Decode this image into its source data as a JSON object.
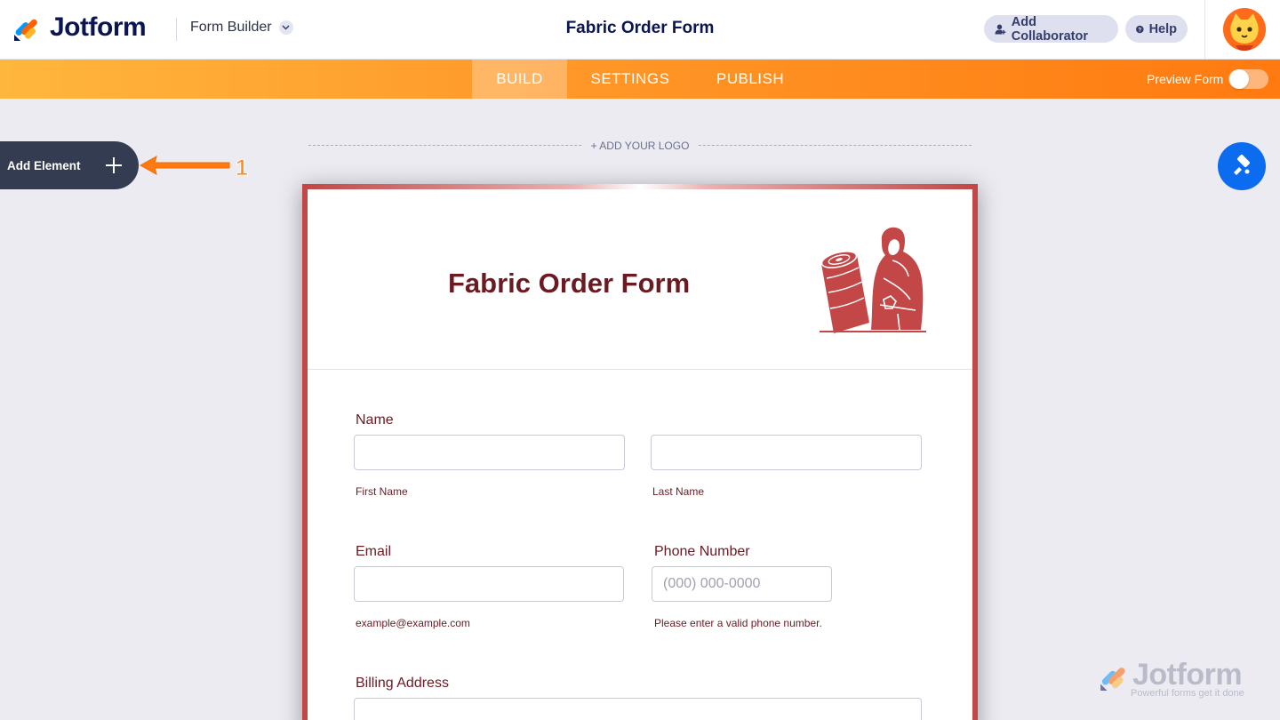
{
  "header": {
    "brand": "Jotform",
    "builder_label": "Form Builder",
    "form_title": "Fabric Order Form",
    "collaborator_label": "Add Collaborator",
    "help_label": "Help"
  },
  "nav": {
    "tabs": [
      {
        "label": "BUILD",
        "active": true
      },
      {
        "label": "SETTINGS",
        "active": false
      },
      {
        "label": "PUBLISH",
        "active": false
      }
    ],
    "preview_label": "Preview Form",
    "preview_on": false
  },
  "sidebar": {
    "add_element_label": "Add Element",
    "annotation_number": "1"
  },
  "canvas": {
    "add_logo_label": "+ ADD YOUR LOGO"
  },
  "form": {
    "heading": "Fabric Order Form",
    "name": {
      "label": "Name",
      "first_sublabel": "First Name",
      "last_sublabel": "Last Name",
      "first_value": "",
      "last_value": ""
    },
    "email": {
      "label": "Email",
      "value": "",
      "sublabel": "example@example.com"
    },
    "phone": {
      "label": "Phone Number",
      "placeholder": "(000) 000-0000",
      "sublabel": "Please enter a valid phone number."
    },
    "billing": {
      "label": "Billing Address"
    }
  },
  "watermark": {
    "brand": "Jotform",
    "tagline": "Powerful forms get it done"
  },
  "colors": {
    "brand_navy": "#0a1551",
    "orange": "#ff7a10",
    "form_border": "#c34747",
    "form_text": "#6b1a22",
    "designer_blue": "#0b6cf0"
  }
}
